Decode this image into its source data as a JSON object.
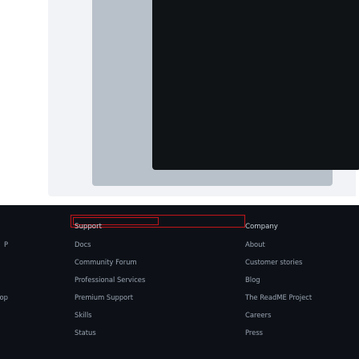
{
  "footer": {
    "left_fragments": [
      "P",
      "top"
    ],
    "support": {
      "heading": "Support",
      "items": [
        "Docs",
        "Community Forum",
        "Professional Services",
        "Premium Support",
        "Skills",
        "Status"
      ]
    },
    "company": {
      "heading": "Company",
      "items": [
        "About",
        "Customer stories",
        "Blog",
        "The ReadME Project",
        "Careers",
        "Press"
      ]
    }
  },
  "colors": {
    "footer_bg": "#0d1117",
    "link": "#9aa4b2",
    "heading": "#c9d1d9",
    "highlight": "#c2151a"
  }
}
